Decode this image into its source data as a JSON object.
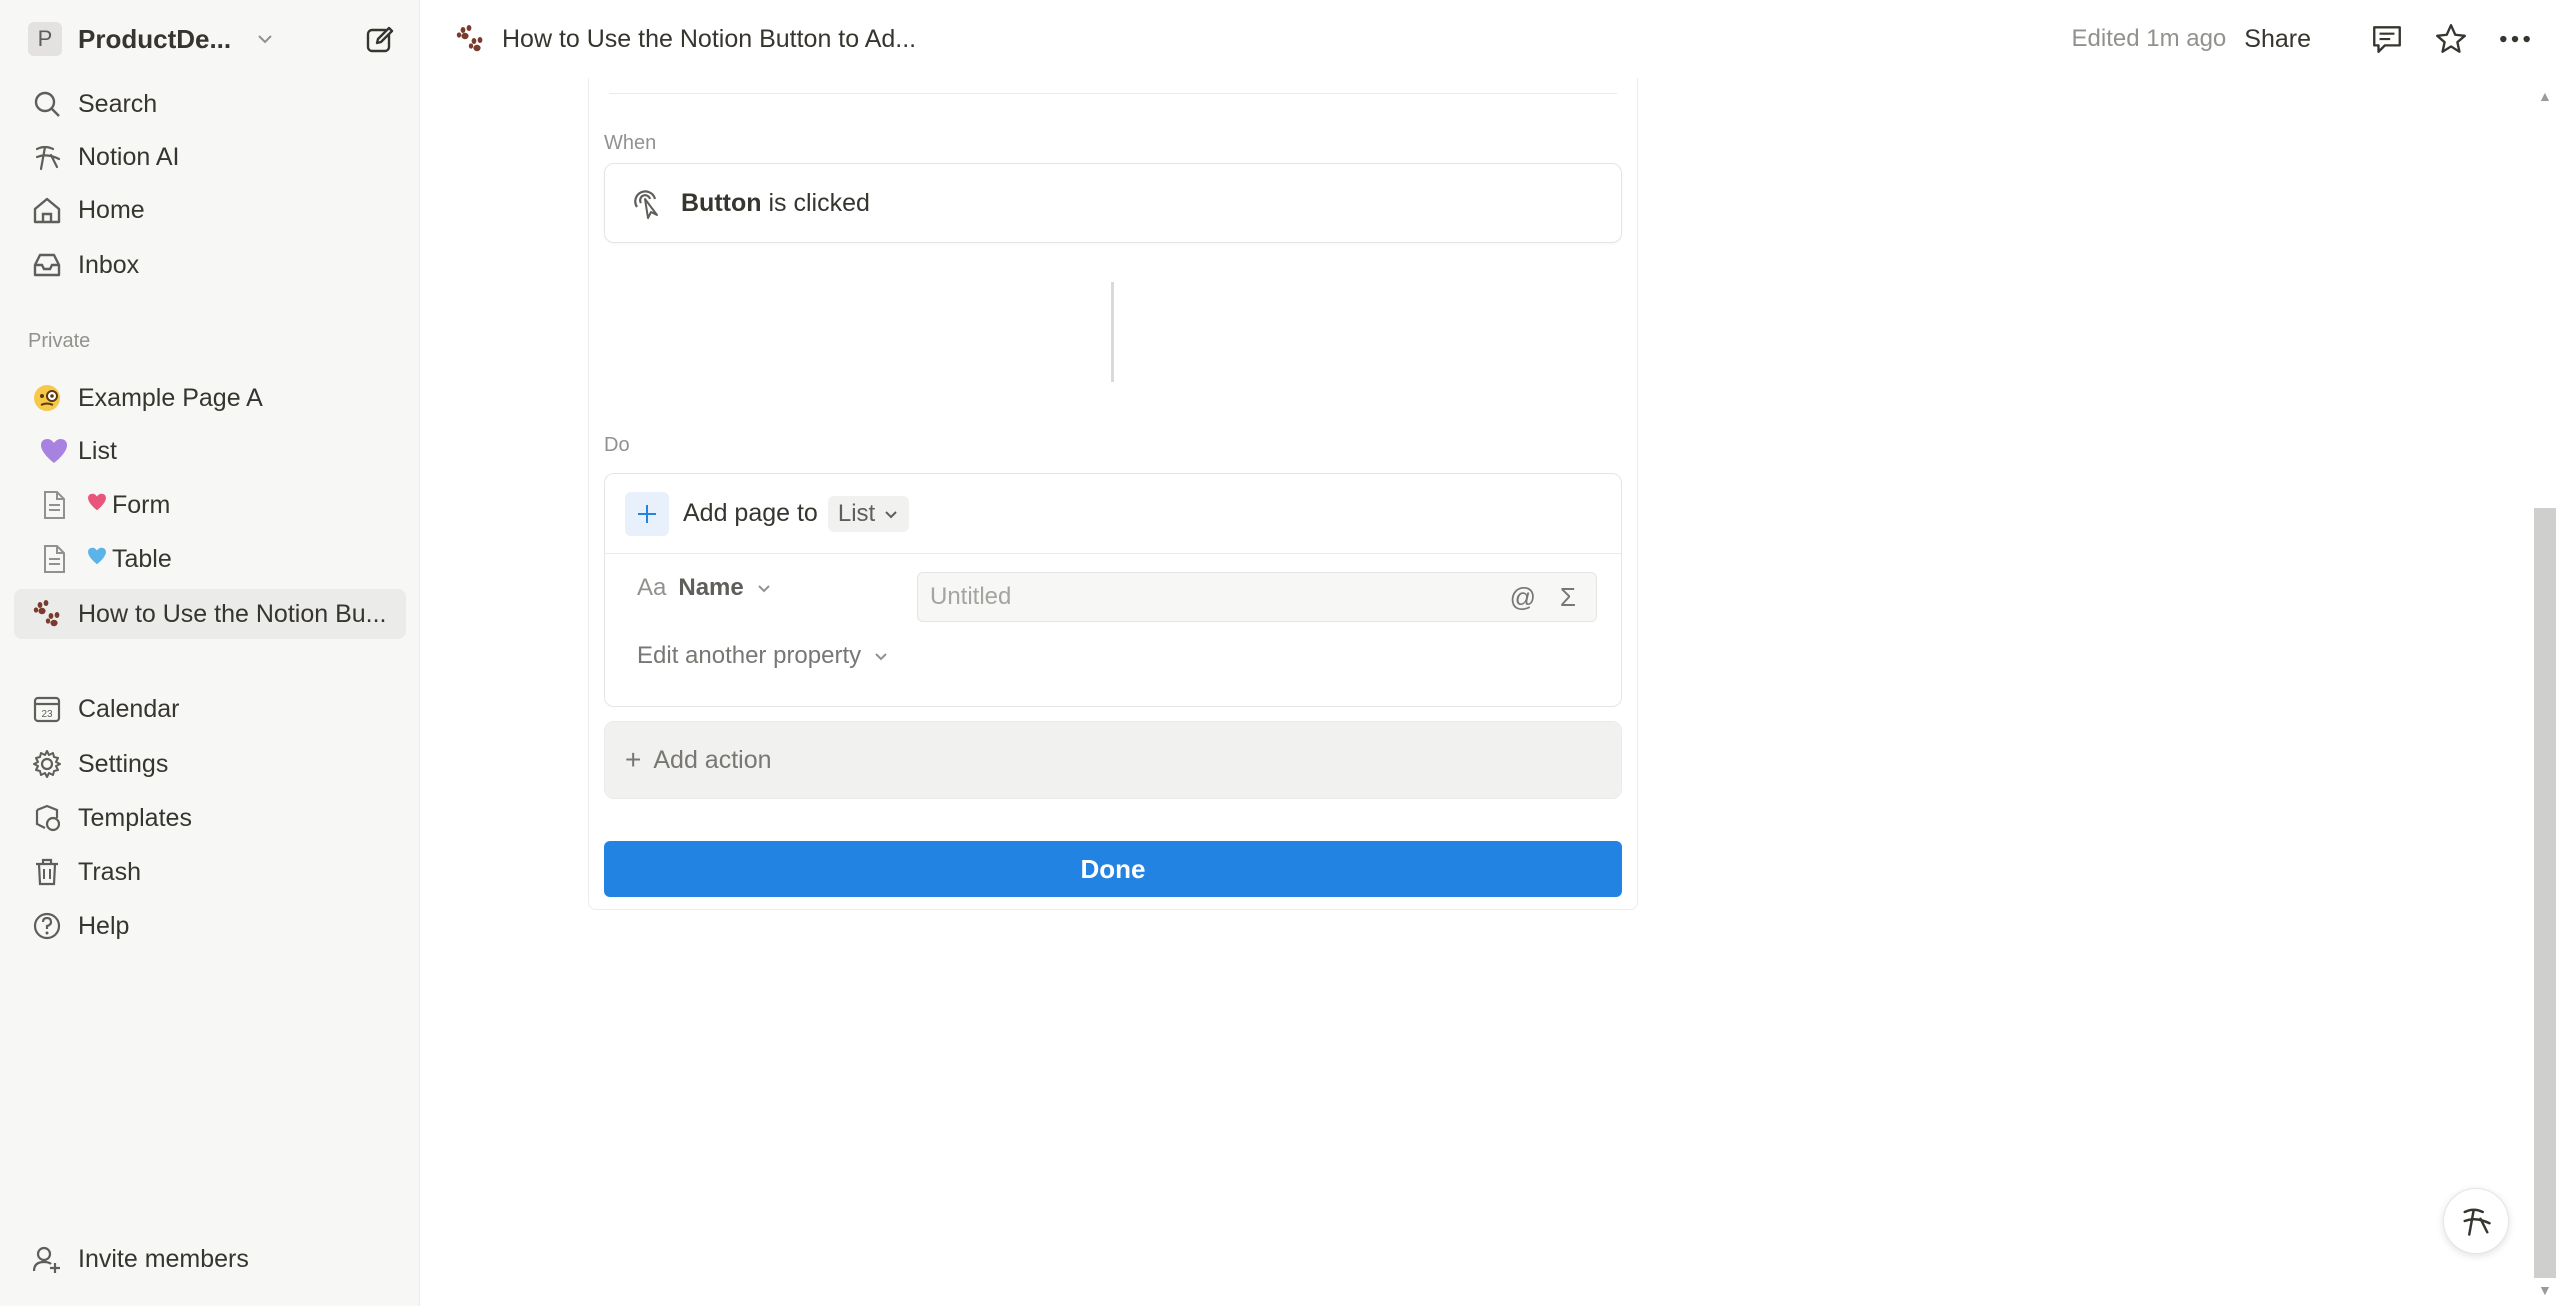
{
  "workspace": {
    "initial": "P",
    "name": "ProductDe..."
  },
  "sidebar": {
    "nav": [
      {
        "label": "Search",
        "icon": "search-icon"
      },
      {
        "label": "Notion AI",
        "icon": "notion-ai-icon"
      },
      {
        "label": "Home",
        "icon": "home-icon"
      },
      {
        "label": "Inbox",
        "icon": "inbox-icon"
      }
    ],
    "section_label": "Private",
    "pages": [
      {
        "label": "Example Page A",
        "icon": "monocle-face-emoji"
      },
      {
        "label": "List",
        "icon": "purple-heart-emoji"
      },
      {
        "label": "Form",
        "icon": "document-icon"
      },
      {
        "label": "Table",
        "icon": "document-icon"
      },
      {
        "label": "How to Use the Notion Bu...",
        "icon": "paw-prints-emoji"
      }
    ],
    "tools": [
      {
        "label": "Calendar",
        "icon": "calendar-icon"
      },
      {
        "label": "Settings",
        "icon": "gear-icon"
      },
      {
        "label": "Templates",
        "icon": "templates-icon"
      },
      {
        "label": "Trash",
        "icon": "trash-icon"
      },
      {
        "label": "Help",
        "icon": "help-icon"
      }
    ],
    "invite_label": "Invite members"
  },
  "topbar": {
    "breadcrumb": "How to Use the Notion Button to Ad...",
    "edited": "Edited 1m ago",
    "share": "Share"
  },
  "automation": {
    "when_label": "When",
    "trigger_bold": "Button",
    "trigger_rest": " is clicked",
    "do_label": "Do",
    "action_text": "Add page to",
    "action_target": "List",
    "property_prefix": "Aa",
    "property_name": "Name",
    "property_placeholder": "Untitled",
    "property_at": "@",
    "property_sigma": "Σ",
    "edit_property": "Edit another property",
    "add_action": "Add action",
    "done": "Done"
  },
  "colors": {
    "accent": "#2383e2",
    "sidebar_bg": "#f7f7f5",
    "text": "#37352f"
  }
}
